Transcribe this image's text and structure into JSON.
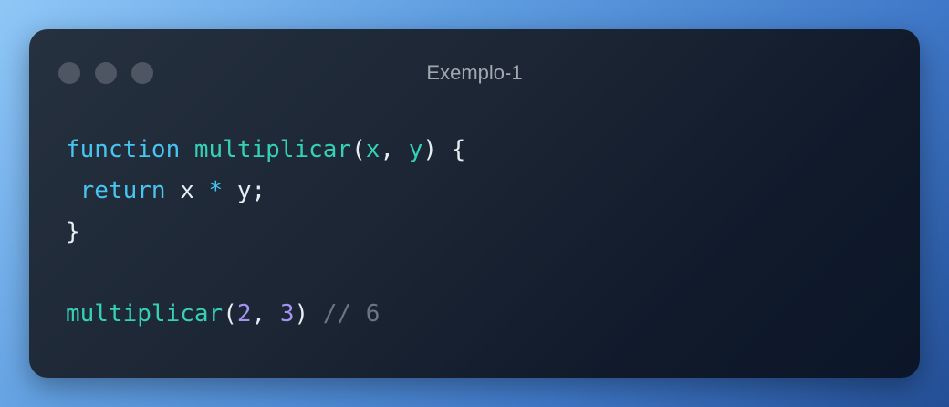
{
  "window": {
    "title": "Exemplo-1",
    "controls": [
      "dot-icon",
      "dot-icon",
      "dot-icon"
    ]
  },
  "code": {
    "line1": {
      "keyword": "function",
      "space1": " ",
      "name": "multiplicar",
      "open": "(",
      "param1": "x",
      "comma": ", ",
      "param2": "y",
      "close": ") {"
    },
    "line2": {
      "indent": " ",
      "keyword": "return",
      "lhs": " x ",
      "op": "*",
      "rhs": " y;"
    },
    "line3": {
      "text": "}"
    },
    "line5": {
      "name": "multiplicar",
      "open": "(",
      "arg1": "2",
      "comma": ", ",
      "arg2": "3",
      "close": ") ",
      "comment": "// 6"
    }
  },
  "colors": {
    "keyword": "#48c4f0",
    "function": "#34d1b5",
    "number": "#a593f2",
    "comment": "#6b7583",
    "text": "#e6edf3"
  }
}
